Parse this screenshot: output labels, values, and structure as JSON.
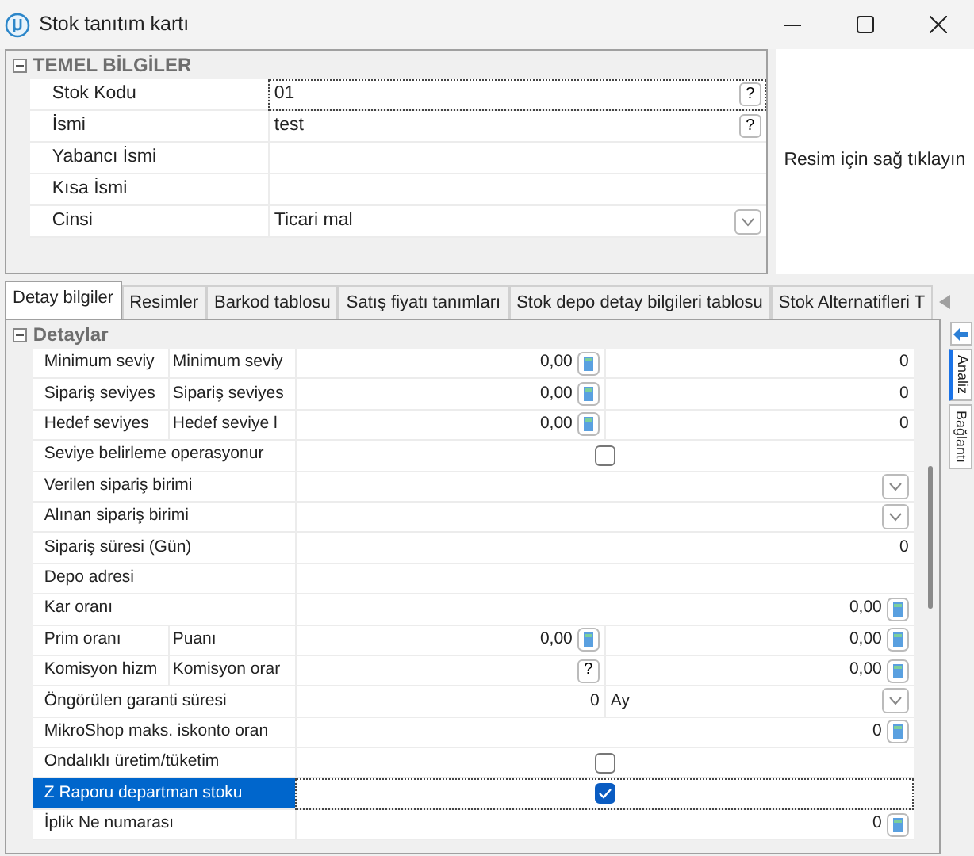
{
  "window": {
    "title": "Stok tanıtım kartı"
  },
  "basic_info": {
    "title": "TEMEL BİLGİLER",
    "expanded": true,
    "fields": [
      {
        "label": "Stok Kodu",
        "value": "01",
        "selected": true,
        "widget": {
          "kind": "help",
          "label": "?"
        }
      },
      {
        "label": "İsmi",
        "value": "test",
        "selected": false,
        "widget": {
          "kind": "help",
          "label": "?"
        }
      },
      {
        "label": "Yabancı İsmi",
        "selected": false
      },
      {
        "label": "Kısa İsmi",
        "selected": false
      },
      {
        "label": "Cinsi",
        "value": "Ticari mal",
        "selected": false,
        "widget": {
          "kind": "dropdown"
        }
      }
    ]
  },
  "image_panel": {
    "hint": "Resim için sağ tıklayın"
  },
  "tabs": [
    {
      "label": "Detay bilgiler",
      "selected": true
    },
    {
      "label": "Resimler",
      "selected": false
    },
    {
      "label": "Barkod tablosu",
      "selected": false
    },
    {
      "label": "Satış fiyatı tanımları",
      "selected": false
    },
    {
      "label": "Stok depo detay bilgileri tablosu",
      "selected": false
    },
    {
      "label": "Stok Alternatifleri T",
      "selected": false
    }
  ],
  "side_tabs": [
    {
      "label": "Analiz",
      "selected": true
    },
    {
      "label": "Bağlantı",
      "selected": false
    }
  ],
  "details": {
    "title": "Detaylar",
    "expanded": true,
    "rows": [
      {
        "label": "Minimum seviy",
        "sublabel": "Minimum seviy",
        "selected": false,
        "cells": [
          {
            "text": "0,00",
            "widget": {
              "kind": "calc"
            }
          },
          {
            "text": "0"
          }
        ]
      },
      {
        "label": "Sipariş seviyes",
        "sublabel": "Sipariş seviyes",
        "selected": false,
        "cells": [
          {
            "text": "0,00",
            "widget": {
              "kind": "calc"
            }
          },
          {
            "text": "0"
          }
        ]
      },
      {
        "label": "Hedef seviyes",
        "sublabel": "Hedef seviye l",
        "selected": false,
        "cells": [
          {
            "text": "0,00",
            "widget": {
              "kind": "calc"
            }
          },
          {
            "text": "0"
          }
        ]
      },
      {
        "label": "Seviye belirleme operasyonur",
        "selected": false,
        "cells": [
          {
            "widget": {
              "kind": "checkbox",
              "checked": false
            }
          }
        ]
      },
      {
        "label": "Verilen sipariş birimi",
        "selected": false,
        "cells": [
          {
            "widget": {
              "kind": "dropdown"
            }
          }
        ]
      },
      {
        "label": "Alınan sipariş birimi",
        "selected": false,
        "cells": [
          {
            "widget": {
              "kind": "dropdown"
            }
          }
        ]
      },
      {
        "label": "Sipariş süresi (Gün)",
        "selected": false,
        "cells": [
          {
            "text": "0"
          }
        ]
      },
      {
        "label": "Depo adresi",
        "selected": false,
        "cells": [
          {}
        ]
      },
      {
        "label": "Kar oranı",
        "selected": false,
        "cells": [
          {
            "text": "0,00",
            "widget": {
              "kind": "calc"
            }
          }
        ]
      },
      {
        "label": "Prim oranı",
        "sublabel": "Puanı",
        "selected": false,
        "cells": [
          {
            "text": "0,00",
            "widget": {
              "kind": "calc"
            }
          },
          {
            "text": "0,00",
            "widget": {
              "kind": "calc"
            }
          }
        ]
      },
      {
        "label": "Komisyon hizm",
        "sublabel": "Komisyon orar",
        "selected": false,
        "cells": [
          {
            "widget": {
              "kind": "help",
              "label": "?"
            }
          },
          {
            "text": "0,00",
            "widget": {
              "kind": "calc"
            }
          }
        ]
      },
      {
        "label": "Öngörülen garanti süresi",
        "selected": false,
        "cells": [
          {
            "text": "0"
          },
          {
            "text": "Ay",
            "widget": {
              "kind": "dropdown"
            }
          }
        ]
      },
      {
        "label": "MikroShop maks. iskonto oran",
        "selected": false,
        "cells": [
          {
            "text": "0",
            "widget": {
              "kind": "calc"
            }
          }
        ]
      },
      {
        "label": "Ondalıklı üretim/tüketim",
        "selected": false,
        "cells": [
          {
            "widget": {
              "kind": "checkbox",
              "checked": false
            }
          }
        ]
      },
      {
        "label": "Z Raporu departman stoku",
        "selected": true,
        "cells": [
          {
            "widget": {
              "kind": "checkbox",
              "checked": true
            }
          }
        ]
      },
      {
        "label": "İplik Ne numarası",
        "selected": false,
        "cells": [
          {
            "text": "0",
            "widget": {
              "kind": "calc"
            }
          }
        ]
      }
    ]
  }
}
